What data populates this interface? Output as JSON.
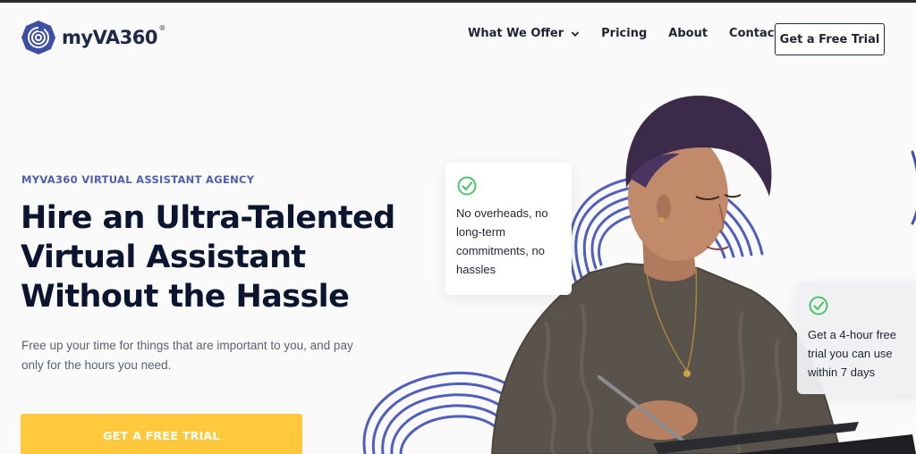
{
  "brand": {
    "name": "myVA360",
    "reg": "®",
    "accent": "#4f5fb0",
    "logo_bg": "#3e4fa3"
  },
  "nav": {
    "items": [
      {
        "label": "What We Offer",
        "has_dropdown": true,
        "icon": "chevron-down-icon"
      },
      {
        "label": "Pricing"
      },
      {
        "label": "About"
      },
      {
        "label": "Contact"
      }
    ],
    "cta_label": "Get a Free Trial"
  },
  "hero": {
    "eyebrow": "MYVA360 VIRTUAL ASSISTANT AGENCY",
    "headline_lines": [
      "Hire an Ultra-Talented",
      "Virtual Assistant",
      "Without the Hassle"
    ],
    "subtext": "Free up your time for things that are important to you, and pay only for the hours you need.",
    "cta_label": "GET A FREE TRIAL",
    "cta_color": "#ffc83d"
  },
  "cards": [
    {
      "icon": "check-circle-icon",
      "text": "No overheads, no long-term commitments, no hassles"
    },
    {
      "icon": "check-circle-icon",
      "text": "Get a 4-hour free trial you can use within 7 days"
    }
  ],
  "colors": {
    "check": "#4ac46b",
    "swirl": "#3e4fb8"
  }
}
